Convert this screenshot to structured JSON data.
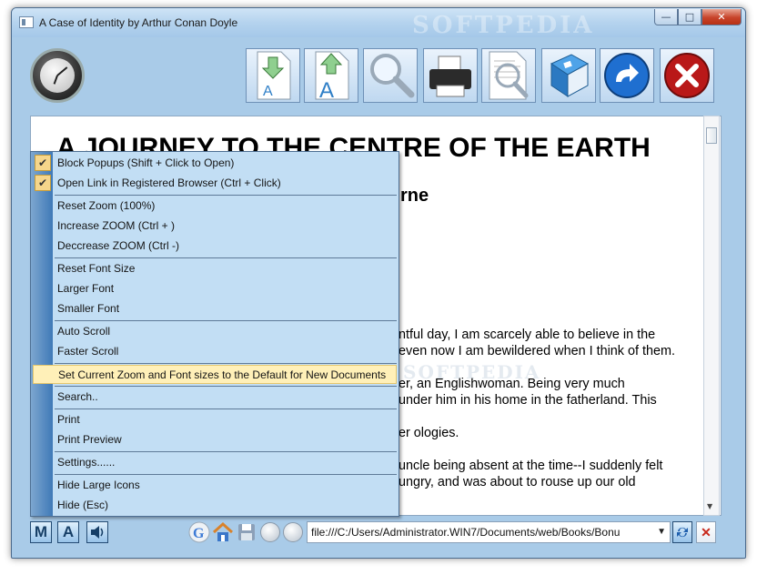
{
  "window": {
    "title": "A Case of Identity by Arthur Conan Doyle",
    "watermark": "SOFTPEDIA"
  },
  "toolbar": {
    "buttons": [
      {
        "icon": "font-decrease-icon"
      },
      {
        "icon": "font-increase-icon"
      },
      {
        "icon": "magnifier-icon"
      },
      {
        "icon": "printer-icon"
      },
      {
        "icon": "print-preview-icon"
      },
      {
        "icon": "book-icon"
      },
      {
        "icon": "forward-icon"
      },
      {
        "icon": "close-icon"
      }
    ]
  },
  "document": {
    "heading": "A JOURNEY TO THE CENTRE OF THE EARTH",
    "subheading_partial": "rne",
    "lines": [
      "ntful day, I am scarcely able to believe in the",
      "even now I am bewildered when I think of them.",
      "er, an Englishwoman. Being very much",
      "under him in his home in the fatherland. This",
      "er ologies.",
      "uncle being absent at the time--I suddenly felt",
      "ungry, and was about to rouse up our old"
    ]
  },
  "menu": {
    "items": [
      {
        "label": "Block Popups (Shift + Click to Open)",
        "checked": true
      },
      {
        "label": "Open Link in Registered Browser (Ctrl + Click)",
        "checked": true
      },
      {
        "label": "Reset Zoom (100%)"
      },
      {
        "label": "Increase ZOOM (Ctrl + )"
      },
      {
        "label": "Deccrease ZOOM (Ctrl -)"
      },
      {
        "label": "Reset Font Size"
      },
      {
        "label": "Larger Font"
      },
      {
        "label": "Smaller Font"
      },
      {
        "label": "Auto Scroll"
      },
      {
        "label": "Faster Scroll"
      },
      {
        "label": "Set Current Zoom and Font sizes to the Default for New Documents",
        "highlighted": true
      },
      {
        "label": "Search.."
      },
      {
        "label": "Print"
      },
      {
        "label": "Print Preview"
      },
      {
        "label": "Settings......"
      },
      {
        "label": "Hide Large Icons"
      },
      {
        "label": "Hide (Esc)"
      }
    ]
  },
  "statusbar": {
    "m_label": "M",
    "a_label": "A",
    "address": "file:///C:/Users/Administrator.WIN7/Documents/web/Books/Bonu"
  },
  "colors": {
    "highlight": "#fff0b8",
    "gutter": "#3f79b7",
    "close": "#c7432a"
  }
}
